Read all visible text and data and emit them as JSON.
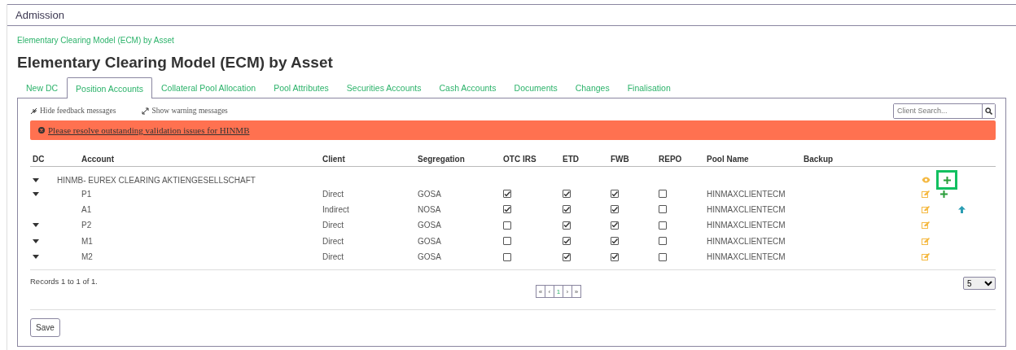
{
  "header": {
    "title": "Admission"
  },
  "breadcrumb": "Elementary Clearing Model (ECM) by Asset",
  "page_title": "Elementary Clearing Model (ECM) by Asset",
  "tabs": [
    {
      "label": "New DC",
      "selected": false
    },
    {
      "label": "Position Accounts",
      "selected": true
    },
    {
      "label": "Collateral Pool Allocation",
      "selected": false
    },
    {
      "label": "Pool Attributes",
      "selected": false
    },
    {
      "label": "Securities Accounts",
      "selected": false
    },
    {
      "label": "Cash Accounts",
      "selected": false
    },
    {
      "label": "Documents",
      "selected": false
    },
    {
      "label": "Changes",
      "selected": false
    },
    {
      "label": "Finalisation",
      "selected": false
    }
  ],
  "feedback_toggles": [
    {
      "kind": "collapse",
      "label": "Hide feedback messages"
    },
    {
      "kind": "expand",
      "label": "Show warning messages"
    }
  ],
  "search": {
    "placeholder": "Client Search..."
  },
  "alert": {
    "text": "Please resolve outstanding validation issues for HINMB"
  },
  "table": {
    "columns": [
      "DC",
      "Account",
      "Client",
      "Segregation",
      "OTC IRS",
      "ETD",
      "FWB",
      "REPO",
      "Pool Name",
      "Backup"
    ],
    "groups": [
      {
        "name": "HINMB- EUREX CLEARING AKTIENGESELLSCHAFT",
        "expanded": true,
        "actions": [
          {
            "kind": "view",
            "highlighted": false
          },
          {
            "kind": "add",
            "highlighted": true
          }
        ],
        "children": [
          {
            "account": "P1",
            "expanded": true,
            "client": "Direct",
            "segregation": "GOSA",
            "otc_irs": true,
            "etd": true,
            "fwb": true,
            "repo": false,
            "pool_name": "HINMAXCLIENTECM",
            "actions": [
              {
                "kind": "edit"
              },
              {
                "kind": "add"
              }
            ],
            "children": [
              {
                "account": "A1",
                "expanded": false,
                "client": "Indirect",
                "segregation": "NOSA",
                "otc_irs": true,
                "etd": true,
                "fwb": true,
                "repo": false,
                "pool_name": "HINMAXCLIENTECM",
                "actions": [
                  {
                    "kind": "edit"
                  },
                  {
                    "kind": "spacer"
                  },
                  {
                    "kind": "up"
                  }
                ]
              }
            ]
          },
          {
            "account": "P2",
            "expanded": true,
            "client": "Direct",
            "segregation": "GOSA",
            "otc_irs": false,
            "etd": true,
            "fwb": true,
            "repo": false,
            "pool_name": "HINMAXCLIENTECM",
            "actions": [
              {
                "kind": "edit"
              }
            ]
          },
          {
            "account": "M1",
            "expanded": true,
            "client": "Direct",
            "segregation": "GOSA",
            "otc_irs": false,
            "etd": true,
            "fwb": true,
            "repo": false,
            "pool_name": "HINMAXCLIENTECM",
            "actions": [
              {
                "kind": "edit"
              }
            ]
          },
          {
            "account": "M2",
            "expanded": true,
            "client": "Direct",
            "segregation": "GOSA",
            "otc_irs": false,
            "etd": true,
            "fwb": true,
            "repo": false,
            "pool_name": "HINMAXCLIENTECM",
            "actions": [
              {
                "kind": "edit"
              }
            ]
          }
        ]
      }
    ]
  },
  "records": "Records 1 to 1 of 1.",
  "pagination": [
    {
      "label": "«",
      "selected": false
    },
    {
      "label": "‹",
      "selected": false
    },
    {
      "label": "1",
      "selected": true
    },
    {
      "label": "›",
      "selected": false
    },
    {
      "label": "»",
      "selected": false
    }
  ],
  "page_size": {
    "value": "5"
  },
  "buttons": [
    "Save"
  ]
}
